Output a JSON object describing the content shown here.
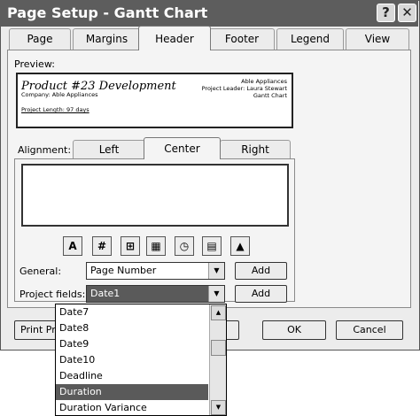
{
  "window": {
    "title": "Page Setup - Gantt Chart",
    "help_label": "?",
    "close_label": "✕"
  },
  "tabs": [
    "Page",
    "Margins",
    "Header",
    "Footer",
    "Legend",
    "View"
  ],
  "active_tab": "Header",
  "preview": {
    "label": "Preview:",
    "title": "Product #23 Development",
    "company": "Company: Able Appliances",
    "project_length": "Project Length: 97 days",
    "right_lines": [
      "Able Appliances",
      "Project Leader: Laura Stewart",
      "Gantt Chart"
    ]
  },
  "alignment": {
    "label": "Alignment:",
    "tabs": [
      "Left",
      "Center",
      "Right"
    ],
    "active": "Center"
  },
  "toolbar_icons": [
    "font-icon",
    "page-number-icon",
    "total-pages-icon",
    "date-icon",
    "time-icon",
    "file-name-icon",
    "insert-picture-icon"
  ],
  "toolbar_glyphs": [
    "A",
    "#",
    "⊞",
    "▦",
    "◷",
    "▤",
    "▲"
  ],
  "general": {
    "label": "General:",
    "value": "Page Number",
    "add_label": "Add"
  },
  "project_fields": {
    "label": "Project fields:",
    "value": "Date1",
    "add_label": "Add"
  },
  "dropdown": {
    "options": [
      "Date7",
      "Date8",
      "Date9",
      "Date10",
      "Deadline",
      "Duration",
      "Duration Variance"
    ],
    "selected": "Duration"
  },
  "buttons": {
    "print_preview": "Print Pre",
    "ok": "OK",
    "cancel": "Cancel"
  }
}
